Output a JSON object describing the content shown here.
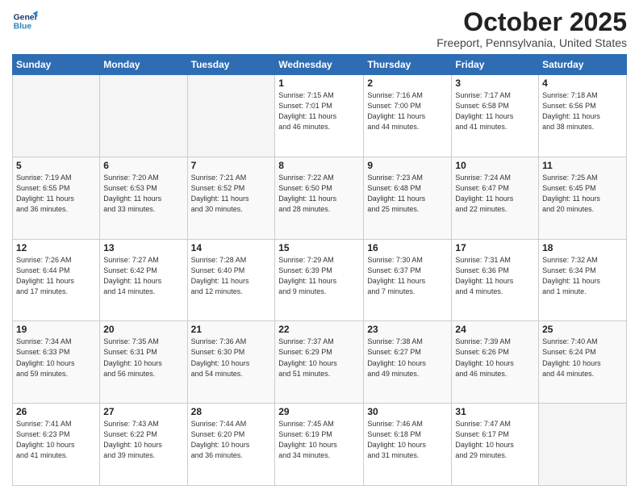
{
  "header": {
    "logo_line1": "General",
    "logo_line2": "Blue",
    "month": "October 2025",
    "location": "Freeport, Pennsylvania, United States"
  },
  "weekdays": [
    "Sunday",
    "Monday",
    "Tuesday",
    "Wednesday",
    "Thursday",
    "Friday",
    "Saturday"
  ],
  "weeks": [
    [
      {
        "day": "",
        "info": ""
      },
      {
        "day": "",
        "info": ""
      },
      {
        "day": "",
        "info": ""
      },
      {
        "day": "1",
        "info": "Sunrise: 7:15 AM\nSunset: 7:01 PM\nDaylight: 11 hours\nand 46 minutes."
      },
      {
        "day": "2",
        "info": "Sunrise: 7:16 AM\nSunset: 7:00 PM\nDaylight: 11 hours\nand 44 minutes."
      },
      {
        "day": "3",
        "info": "Sunrise: 7:17 AM\nSunset: 6:58 PM\nDaylight: 11 hours\nand 41 minutes."
      },
      {
        "day": "4",
        "info": "Sunrise: 7:18 AM\nSunset: 6:56 PM\nDaylight: 11 hours\nand 38 minutes."
      }
    ],
    [
      {
        "day": "5",
        "info": "Sunrise: 7:19 AM\nSunset: 6:55 PM\nDaylight: 11 hours\nand 36 minutes."
      },
      {
        "day": "6",
        "info": "Sunrise: 7:20 AM\nSunset: 6:53 PM\nDaylight: 11 hours\nand 33 minutes."
      },
      {
        "day": "7",
        "info": "Sunrise: 7:21 AM\nSunset: 6:52 PM\nDaylight: 11 hours\nand 30 minutes."
      },
      {
        "day": "8",
        "info": "Sunrise: 7:22 AM\nSunset: 6:50 PM\nDaylight: 11 hours\nand 28 minutes."
      },
      {
        "day": "9",
        "info": "Sunrise: 7:23 AM\nSunset: 6:48 PM\nDaylight: 11 hours\nand 25 minutes."
      },
      {
        "day": "10",
        "info": "Sunrise: 7:24 AM\nSunset: 6:47 PM\nDaylight: 11 hours\nand 22 minutes."
      },
      {
        "day": "11",
        "info": "Sunrise: 7:25 AM\nSunset: 6:45 PM\nDaylight: 11 hours\nand 20 minutes."
      }
    ],
    [
      {
        "day": "12",
        "info": "Sunrise: 7:26 AM\nSunset: 6:44 PM\nDaylight: 11 hours\nand 17 minutes."
      },
      {
        "day": "13",
        "info": "Sunrise: 7:27 AM\nSunset: 6:42 PM\nDaylight: 11 hours\nand 14 minutes."
      },
      {
        "day": "14",
        "info": "Sunrise: 7:28 AM\nSunset: 6:40 PM\nDaylight: 11 hours\nand 12 minutes."
      },
      {
        "day": "15",
        "info": "Sunrise: 7:29 AM\nSunset: 6:39 PM\nDaylight: 11 hours\nand 9 minutes."
      },
      {
        "day": "16",
        "info": "Sunrise: 7:30 AM\nSunset: 6:37 PM\nDaylight: 11 hours\nand 7 minutes."
      },
      {
        "day": "17",
        "info": "Sunrise: 7:31 AM\nSunset: 6:36 PM\nDaylight: 11 hours\nand 4 minutes."
      },
      {
        "day": "18",
        "info": "Sunrise: 7:32 AM\nSunset: 6:34 PM\nDaylight: 11 hours\nand 1 minute."
      }
    ],
    [
      {
        "day": "19",
        "info": "Sunrise: 7:34 AM\nSunset: 6:33 PM\nDaylight: 10 hours\nand 59 minutes."
      },
      {
        "day": "20",
        "info": "Sunrise: 7:35 AM\nSunset: 6:31 PM\nDaylight: 10 hours\nand 56 minutes."
      },
      {
        "day": "21",
        "info": "Sunrise: 7:36 AM\nSunset: 6:30 PM\nDaylight: 10 hours\nand 54 minutes."
      },
      {
        "day": "22",
        "info": "Sunrise: 7:37 AM\nSunset: 6:29 PM\nDaylight: 10 hours\nand 51 minutes."
      },
      {
        "day": "23",
        "info": "Sunrise: 7:38 AM\nSunset: 6:27 PM\nDaylight: 10 hours\nand 49 minutes."
      },
      {
        "day": "24",
        "info": "Sunrise: 7:39 AM\nSunset: 6:26 PM\nDaylight: 10 hours\nand 46 minutes."
      },
      {
        "day": "25",
        "info": "Sunrise: 7:40 AM\nSunset: 6:24 PM\nDaylight: 10 hours\nand 44 minutes."
      }
    ],
    [
      {
        "day": "26",
        "info": "Sunrise: 7:41 AM\nSunset: 6:23 PM\nDaylight: 10 hours\nand 41 minutes."
      },
      {
        "day": "27",
        "info": "Sunrise: 7:43 AM\nSunset: 6:22 PM\nDaylight: 10 hours\nand 39 minutes."
      },
      {
        "day": "28",
        "info": "Sunrise: 7:44 AM\nSunset: 6:20 PM\nDaylight: 10 hours\nand 36 minutes."
      },
      {
        "day": "29",
        "info": "Sunrise: 7:45 AM\nSunset: 6:19 PM\nDaylight: 10 hours\nand 34 minutes."
      },
      {
        "day": "30",
        "info": "Sunrise: 7:46 AM\nSunset: 6:18 PM\nDaylight: 10 hours\nand 31 minutes."
      },
      {
        "day": "31",
        "info": "Sunrise: 7:47 AM\nSunset: 6:17 PM\nDaylight: 10 hours\nand 29 minutes."
      },
      {
        "day": "",
        "info": ""
      }
    ]
  ]
}
